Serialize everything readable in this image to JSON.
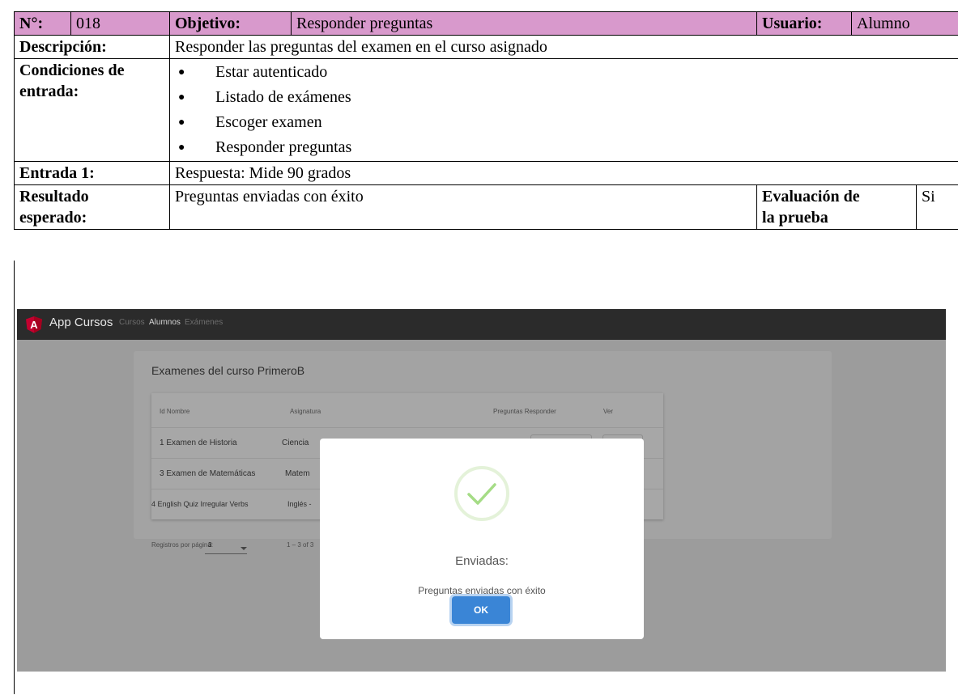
{
  "header": {
    "n_label": "N°:",
    "n_value": "018",
    "objetivo_label": "Objetivo:",
    "objetivo_value": "Responder preguntas",
    "usuario_label": "Usuario:",
    "usuario_value": "Alumno"
  },
  "descripcion": {
    "label": "Descripción:",
    "value": "Responder las preguntas del examen en el curso asignado"
  },
  "condiciones": {
    "label_line1": "Condiciones de",
    "label_line2": "entrada:",
    "items": [
      "Estar autenticado",
      "Listado de exámenes",
      "Escoger examen",
      "Responder preguntas"
    ]
  },
  "entrada1": {
    "label": "Entrada 1:",
    "value": "Respuesta: Mide 90 grados"
  },
  "resultado": {
    "label_line1": "Resultado",
    "label_line2": "esperado:",
    "value": "Preguntas enviadas con éxito",
    "evaluacion_line1": "Evaluación de",
    "evaluacion_line2": "la prueba",
    "evaluacion_value": "Si"
  },
  "screenshot": {
    "app_title": "App Cursos",
    "nav": [
      "Cursos",
      "Alumnos",
      "Exámenes"
    ],
    "active_nav": "Alumnos",
    "card_title": "Examenes del curso PrimeroB",
    "columns": [
      "Id Nombre",
      "Asignatura",
      "Preguntas Responder",
      "Ver"
    ],
    "rows": [
      {
        "name": "1 Examen de Historia",
        "subject": "Ciencia"
      },
      {
        "name": "3 Examen de Matemáticas",
        "subject": "Matem"
      },
      {
        "name": "4 English Quiz Irregular Verbs",
        "subject": "Inglés -"
      }
    ],
    "paginator_label": "Registros por página:",
    "paginator_value": "3",
    "paginator_range": "1 – 3 of 3",
    "modal_title": "Enviadas:",
    "modal_text": "Preguntas enviadas con éxito",
    "modal_button": "OK",
    "colors": {
      "navbar": "#2b2b2b",
      "angular_red": "#c3002f",
      "ok_button": "#3a85d6",
      "success_green": "#a5dc86"
    }
  }
}
